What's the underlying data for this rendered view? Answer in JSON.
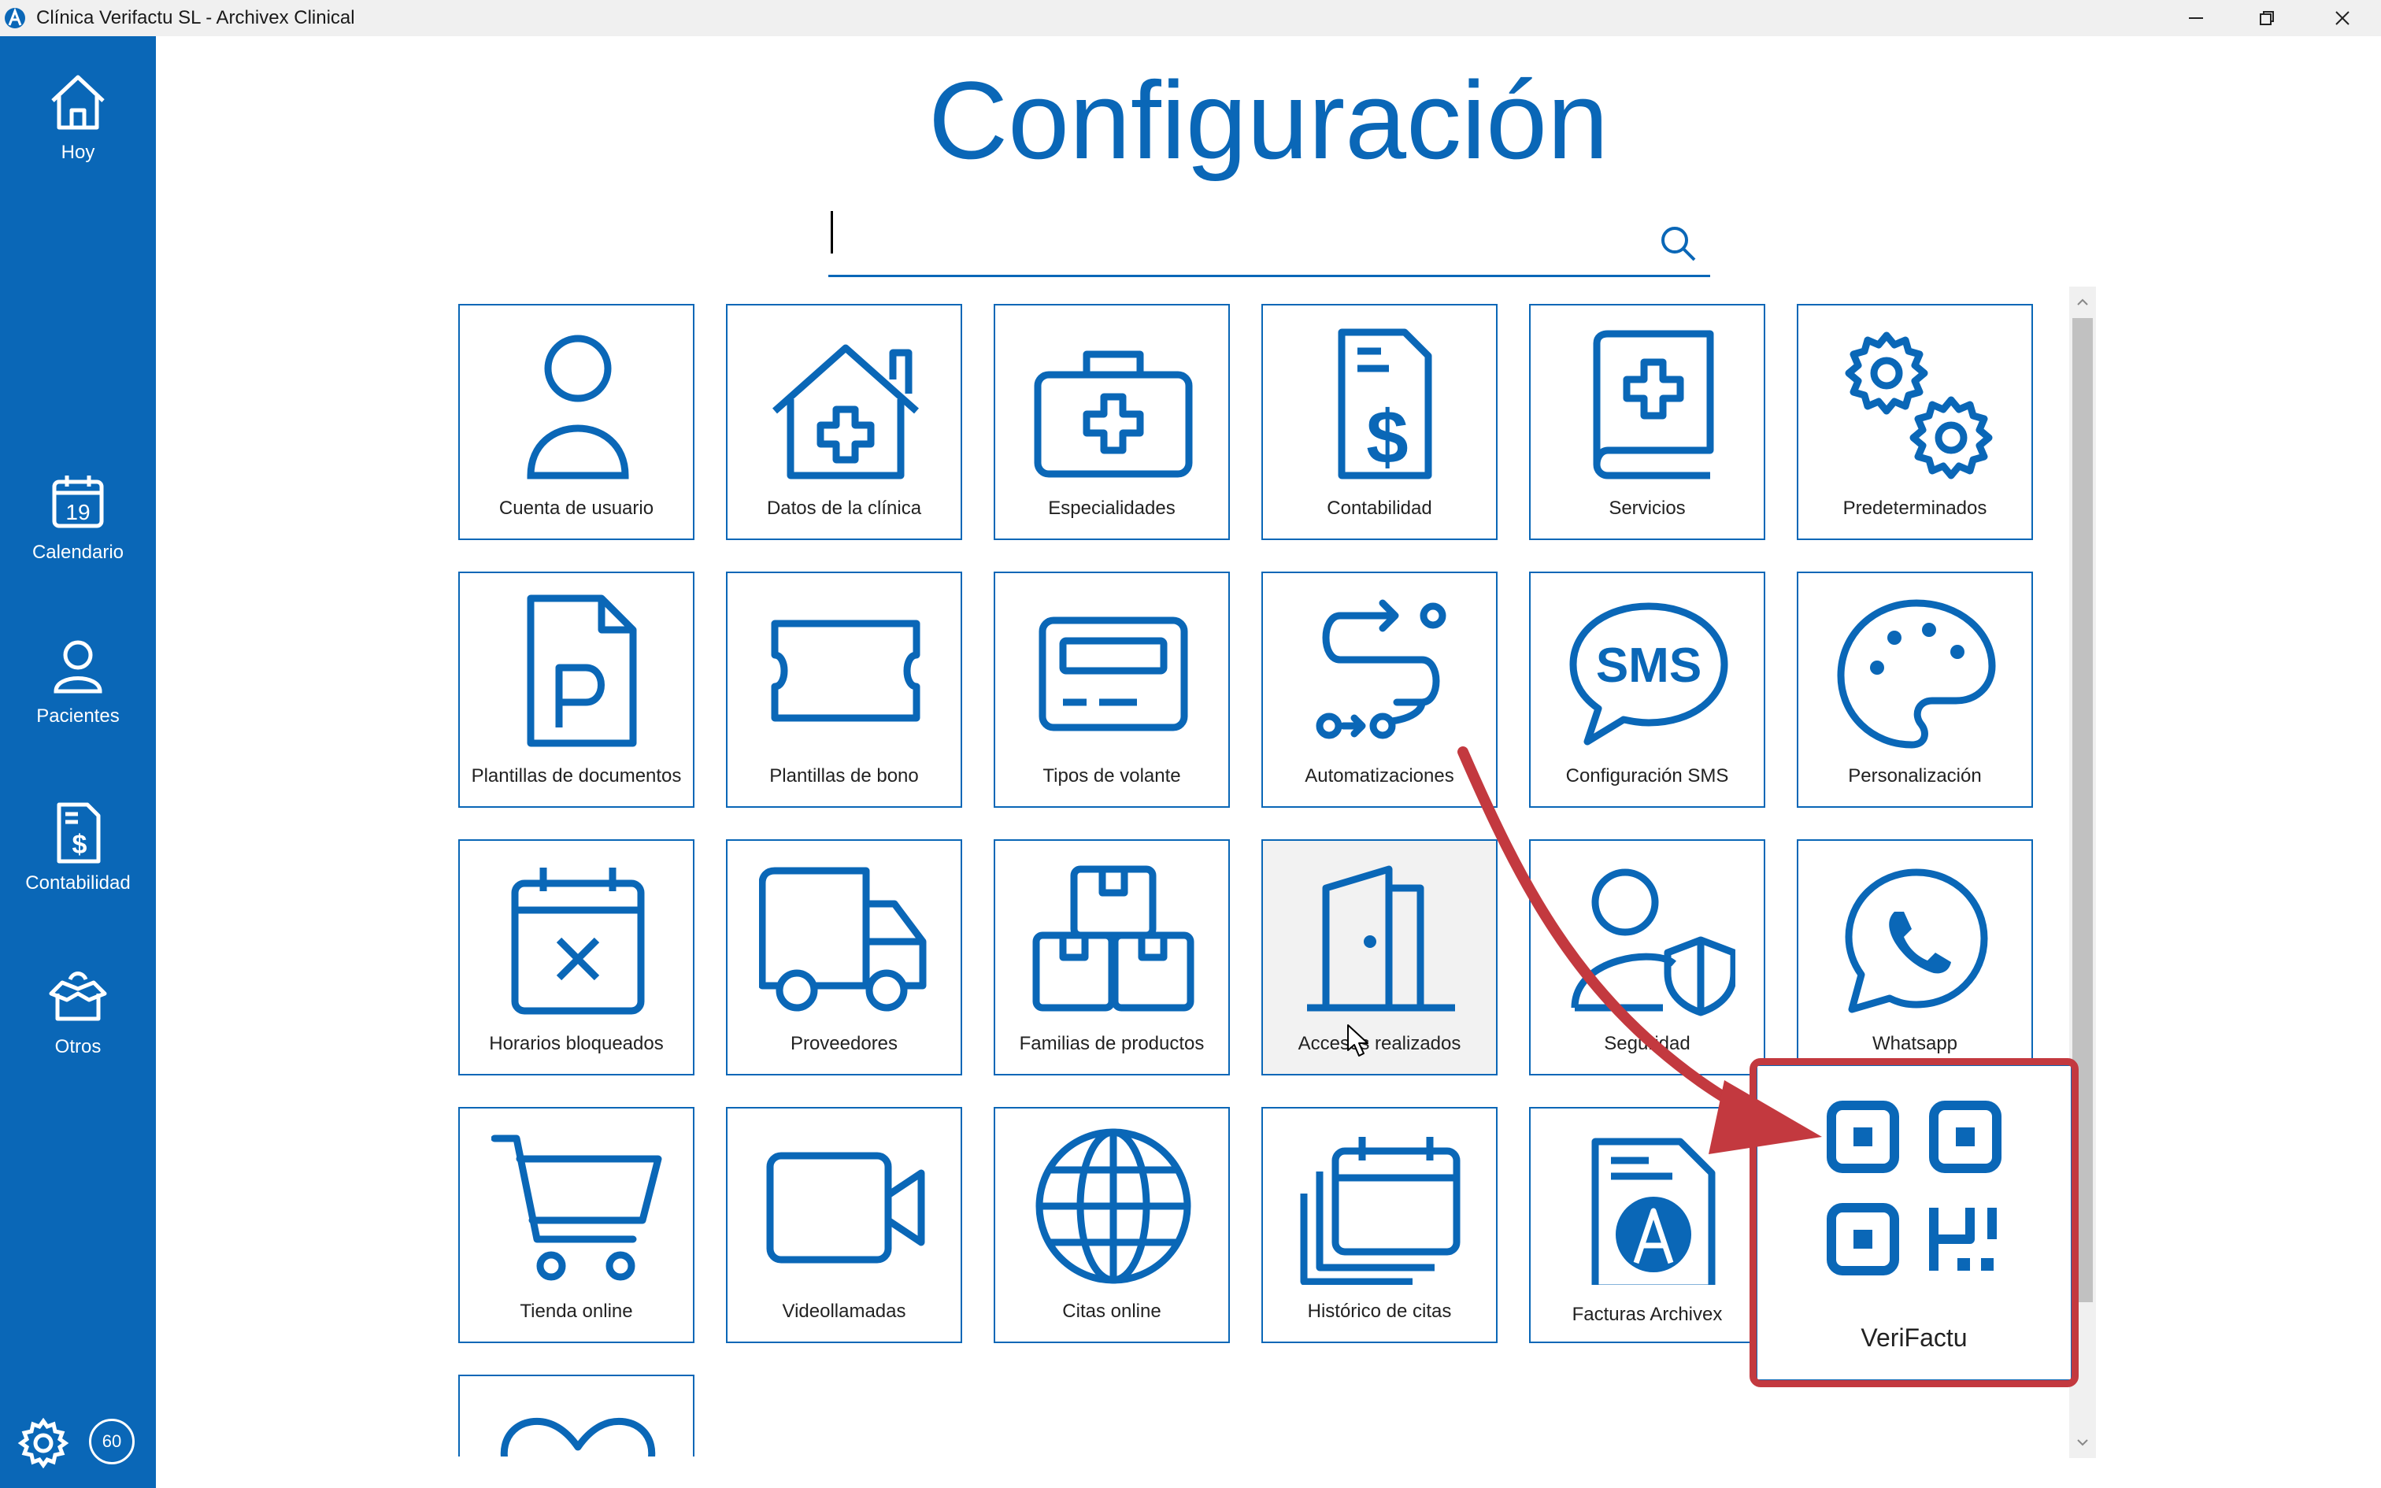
{
  "window": {
    "title": "Clínica Verifactu SL - Archivex Clinical",
    "controls": [
      "minimize",
      "restore",
      "close"
    ]
  },
  "sidebar": {
    "items": [
      {
        "label": "Hoy",
        "icon": "home-icon"
      },
      {
        "label": "Calendario",
        "icon": "calendar-icon",
        "day": "19"
      },
      {
        "label": "Pacientes",
        "icon": "person-icon"
      },
      {
        "label": "Contabilidad",
        "icon": "invoice-icon"
      },
      {
        "label": "Otros",
        "icon": "open-box-icon"
      }
    ],
    "settings_icon": "gear-icon",
    "counter": "60"
  },
  "main": {
    "title": "Configuración",
    "search": {
      "value": "",
      "placeholder": ""
    },
    "tiles": [
      {
        "label": "Cuenta de usuario",
        "icon": "user-icon"
      },
      {
        "label": "Datos de la clínica",
        "icon": "clinic-house-icon"
      },
      {
        "label": "Especialidades",
        "icon": "medical-kit-icon"
      },
      {
        "label": "Contabilidad",
        "icon": "invoice-dollar-icon"
      },
      {
        "label": "Servicios",
        "icon": "medical-book-icon"
      },
      {
        "label": "Predeterminados",
        "icon": "gears-icon"
      },
      {
        "label": "Plantillas de documentos",
        "icon": "document-p-icon"
      },
      {
        "label": "Plantillas de bono",
        "icon": "ticket-icon"
      },
      {
        "label": "Tipos de volante",
        "icon": "voucher-card-icon"
      },
      {
        "label": "Automatizaciones",
        "icon": "workflow-icon"
      },
      {
        "label": "Configuración SMS",
        "icon": "sms-bubble-icon"
      },
      {
        "label": "Personalización",
        "icon": "palette-icon"
      },
      {
        "label": "Horarios bloqueados",
        "icon": "calendar-x-icon"
      },
      {
        "label": "Proveedores",
        "icon": "truck-icon"
      },
      {
        "label": "Familias de productos",
        "icon": "boxes-icon"
      },
      {
        "label": "Accesos realizados",
        "icon": "door-icon"
      },
      {
        "label": "Seguridad",
        "icon": "user-shield-icon"
      },
      {
        "label": "Whatsapp",
        "icon": "whatsapp-icon"
      },
      {
        "label": "Tienda online",
        "icon": "cart-icon"
      },
      {
        "label": "Videollamadas",
        "icon": "video-camera-icon"
      },
      {
        "label": "Citas online",
        "icon": "globe-icon"
      },
      {
        "label": "Histórico de citas",
        "icon": "calendar-stack-icon"
      },
      {
        "label": "Facturas Archivex",
        "icon": "archivex-invoice-icon"
      },
      {
        "label": "",
        "icon": "heart-icon"
      }
    ],
    "highlighted_tile": {
      "label": "VeriFactu",
      "icon": "qr-code-icon"
    }
  },
  "colors": {
    "brand": "#0a67b7",
    "sidebar": "#0a67b7",
    "annotation": "#c3393f"
  }
}
